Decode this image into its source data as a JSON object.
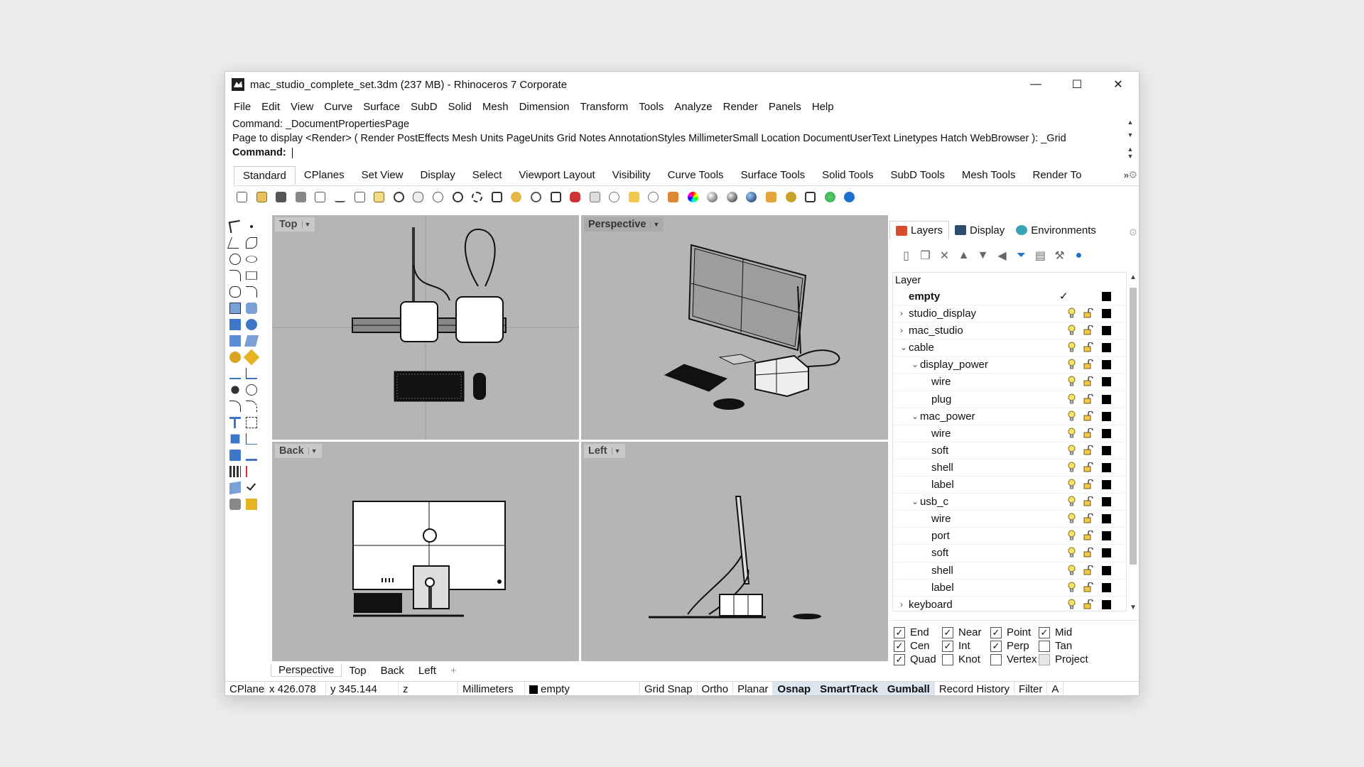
{
  "window": {
    "title": "mac_studio_complete_set.3dm (237 MB) - Rhinoceros 7 Corporate",
    "controls": {
      "minimize": "—",
      "maximize": "☐",
      "close": "✕"
    }
  },
  "menu": [
    "File",
    "Edit",
    "View",
    "Curve",
    "Surface",
    "SubD",
    "Solid",
    "Mesh",
    "Dimension",
    "Transform",
    "Tools",
    "Analyze",
    "Render",
    "Panels",
    "Help"
  ],
  "command": {
    "history1": "Command: _DocumentPropertiesPage",
    "history2": "Page to display <Render> ( Render  PostEffects  Mesh  Units  PageUnits  Grid  Notes  AnnotationStyles  MillimeterSmall  Location  DocumentUserText  Linetypes  Hatch  WebBrowser ): _Grid",
    "prompt": "Command:",
    "input": ""
  },
  "toolbar_tabs": [
    "Standard",
    "CPlanes",
    "Set View",
    "Display",
    "Select",
    "Viewport Layout",
    "Visibility",
    "Curve Tools",
    "Surface Tools",
    "Solid Tools",
    "SubD Tools",
    "Mesh Tools",
    "Render To"
  ],
  "toolbar_more": "»",
  "viewports": {
    "top": "Top",
    "perspective": "Perspective",
    "back": "Back",
    "left": "Left"
  },
  "viewport_tabs": [
    "Perspective",
    "Top",
    "Back",
    "Left"
  ],
  "viewport_tab_add": "+",
  "panel": {
    "tabs": [
      "Layers",
      "Display",
      "Environments"
    ],
    "layer_header": "Layer",
    "layers": [
      {
        "name": "empty",
        "indent": 0,
        "expander": "",
        "current": true
      },
      {
        "name": "studio_display",
        "indent": 0,
        "expander": "›"
      },
      {
        "name": "mac_studio",
        "indent": 0,
        "expander": "›"
      },
      {
        "name": "cable",
        "indent": 0,
        "expander": "⌄"
      },
      {
        "name": "display_power",
        "indent": 1,
        "expander": "⌄"
      },
      {
        "name": "wire",
        "indent": 2,
        "expander": ""
      },
      {
        "name": "plug",
        "indent": 2,
        "expander": ""
      },
      {
        "name": "mac_power",
        "indent": 1,
        "expander": "⌄"
      },
      {
        "name": "wire",
        "indent": 2,
        "expander": ""
      },
      {
        "name": "soft",
        "indent": 2,
        "expander": ""
      },
      {
        "name": "shell",
        "indent": 2,
        "expander": ""
      },
      {
        "name": "label",
        "indent": 2,
        "expander": ""
      },
      {
        "name": "usb_c",
        "indent": 1,
        "expander": "⌄"
      },
      {
        "name": "wire",
        "indent": 2,
        "expander": ""
      },
      {
        "name": "port",
        "indent": 2,
        "expander": ""
      },
      {
        "name": "soft",
        "indent": 2,
        "expander": ""
      },
      {
        "name": "shell",
        "indent": 2,
        "expander": ""
      },
      {
        "name": "label",
        "indent": 2,
        "expander": ""
      },
      {
        "name": "keyboard",
        "indent": 0,
        "expander": "›"
      }
    ],
    "osnaps": [
      {
        "label": "End",
        "checked": true
      },
      {
        "label": "Near",
        "checked": true
      },
      {
        "label": "Point",
        "checked": true
      },
      {
        "label": "Mid",
        "checked": true
      },
      {
        "label": "Cen",
        "checked": true
      },
      {
        "label": "Int",
        "checked": true
      },
      {
        "label": "Perp",
        "checked": true
      },
      {
        "label": "Tan",
        "checked": false
      },
      {
        "label": "Quad",
        "checked": true
      },
      {
        "label": "Knot",
        "checked": false
      },
      {
        "label": "Vertex",
        "checked": false
      },
      {
        "label": "Project",
        "checked": false,
        "disabled": true
      }
    ]
  },
  "status": {
    "cplane": "CPlane",
    "x": "x 426.078",
    "y": "y 345.144",
    "z": "z",
    "units": "Millimeters",
    "layer": "empty",
    "toggles": [
      {
        "label": "Grid Snap",
        "on": false
      },
      {
        "label": "Ortho",
        "on": false
      },
      {
        "label": "Planar",
        "on": false
      },
      {
        "label": "Osnap",
        "on": true
      },
      {
        "label": "SmartTrack",
        "on": true
      },
      {
        "label": "Gumball",
        "on": true
      },
      {
        "label": "Record History",
        "on": false
      },
      {
        "label": "Filter",
        "on": false
      },
      {
        "label": "A",
        "on": false
      }
    ]
  },
  "colors": {
    "viewport_bg": "#b5b5b5",
    "active_toggle": "#dde6f0",
    "accent_blue": "#1f6fd1"
  }
}
